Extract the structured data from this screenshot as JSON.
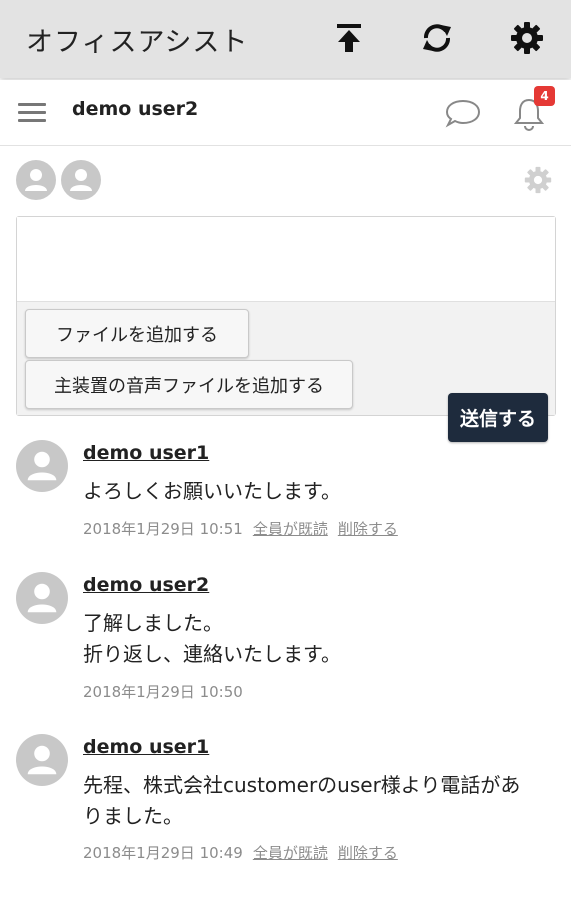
{
  "app": {
    "title": "オフィスアシスト",
    "icons": [
      "upload-icon",
      "sync-icon",
      "gear-icon"
    ]
  },
  "subbar": {
    "user_name": "demo user2",
    "notification_count": "4",
    "icons": [
      "hamburger-menu-icon",
      "chat-bubble-icon",
      "bell-icon"
    ]
  },
  "composer": {
    "text_value": "",
    "add_file_label": "ファイルを追加する",
    "add_audio_label": "主装置の音声ファイルを追加する",
    "send_label": "送信する"
  },
  "messages": [
    {
      "author": "demo user1",
      "text": "よろしくお願いいたします。",
      "timestamp": "2018年1月29日 10:51",
      "read_link": "全員が既読",
      "delete_link": "削除する"
    },
    {
      "author": "demo user2",
      "text_lines": [
        "了解しました。",
        "折り返し、連絡いたします。"
      ],
      "timestamp": "2018年1月29日 10:50"
    },
    {
      "author": "demo user1",
      "text_lines": [
        "先程、株式会社customerのuser様より電話があ",
        "りました。"
      ],
      "timestamp": "2018年1月29日 10:49",
      "read_link": "全員が既読",
      "delete_link": "削除する"
    }
  ],
  "colors": {
    "appbar_bg": "#e3e3e3",
    "send_button_bg": "#1e2b3d",
    "badge_bg": "#e53935",
    "avatar_bg": "#c8c8c8"
  }
}
